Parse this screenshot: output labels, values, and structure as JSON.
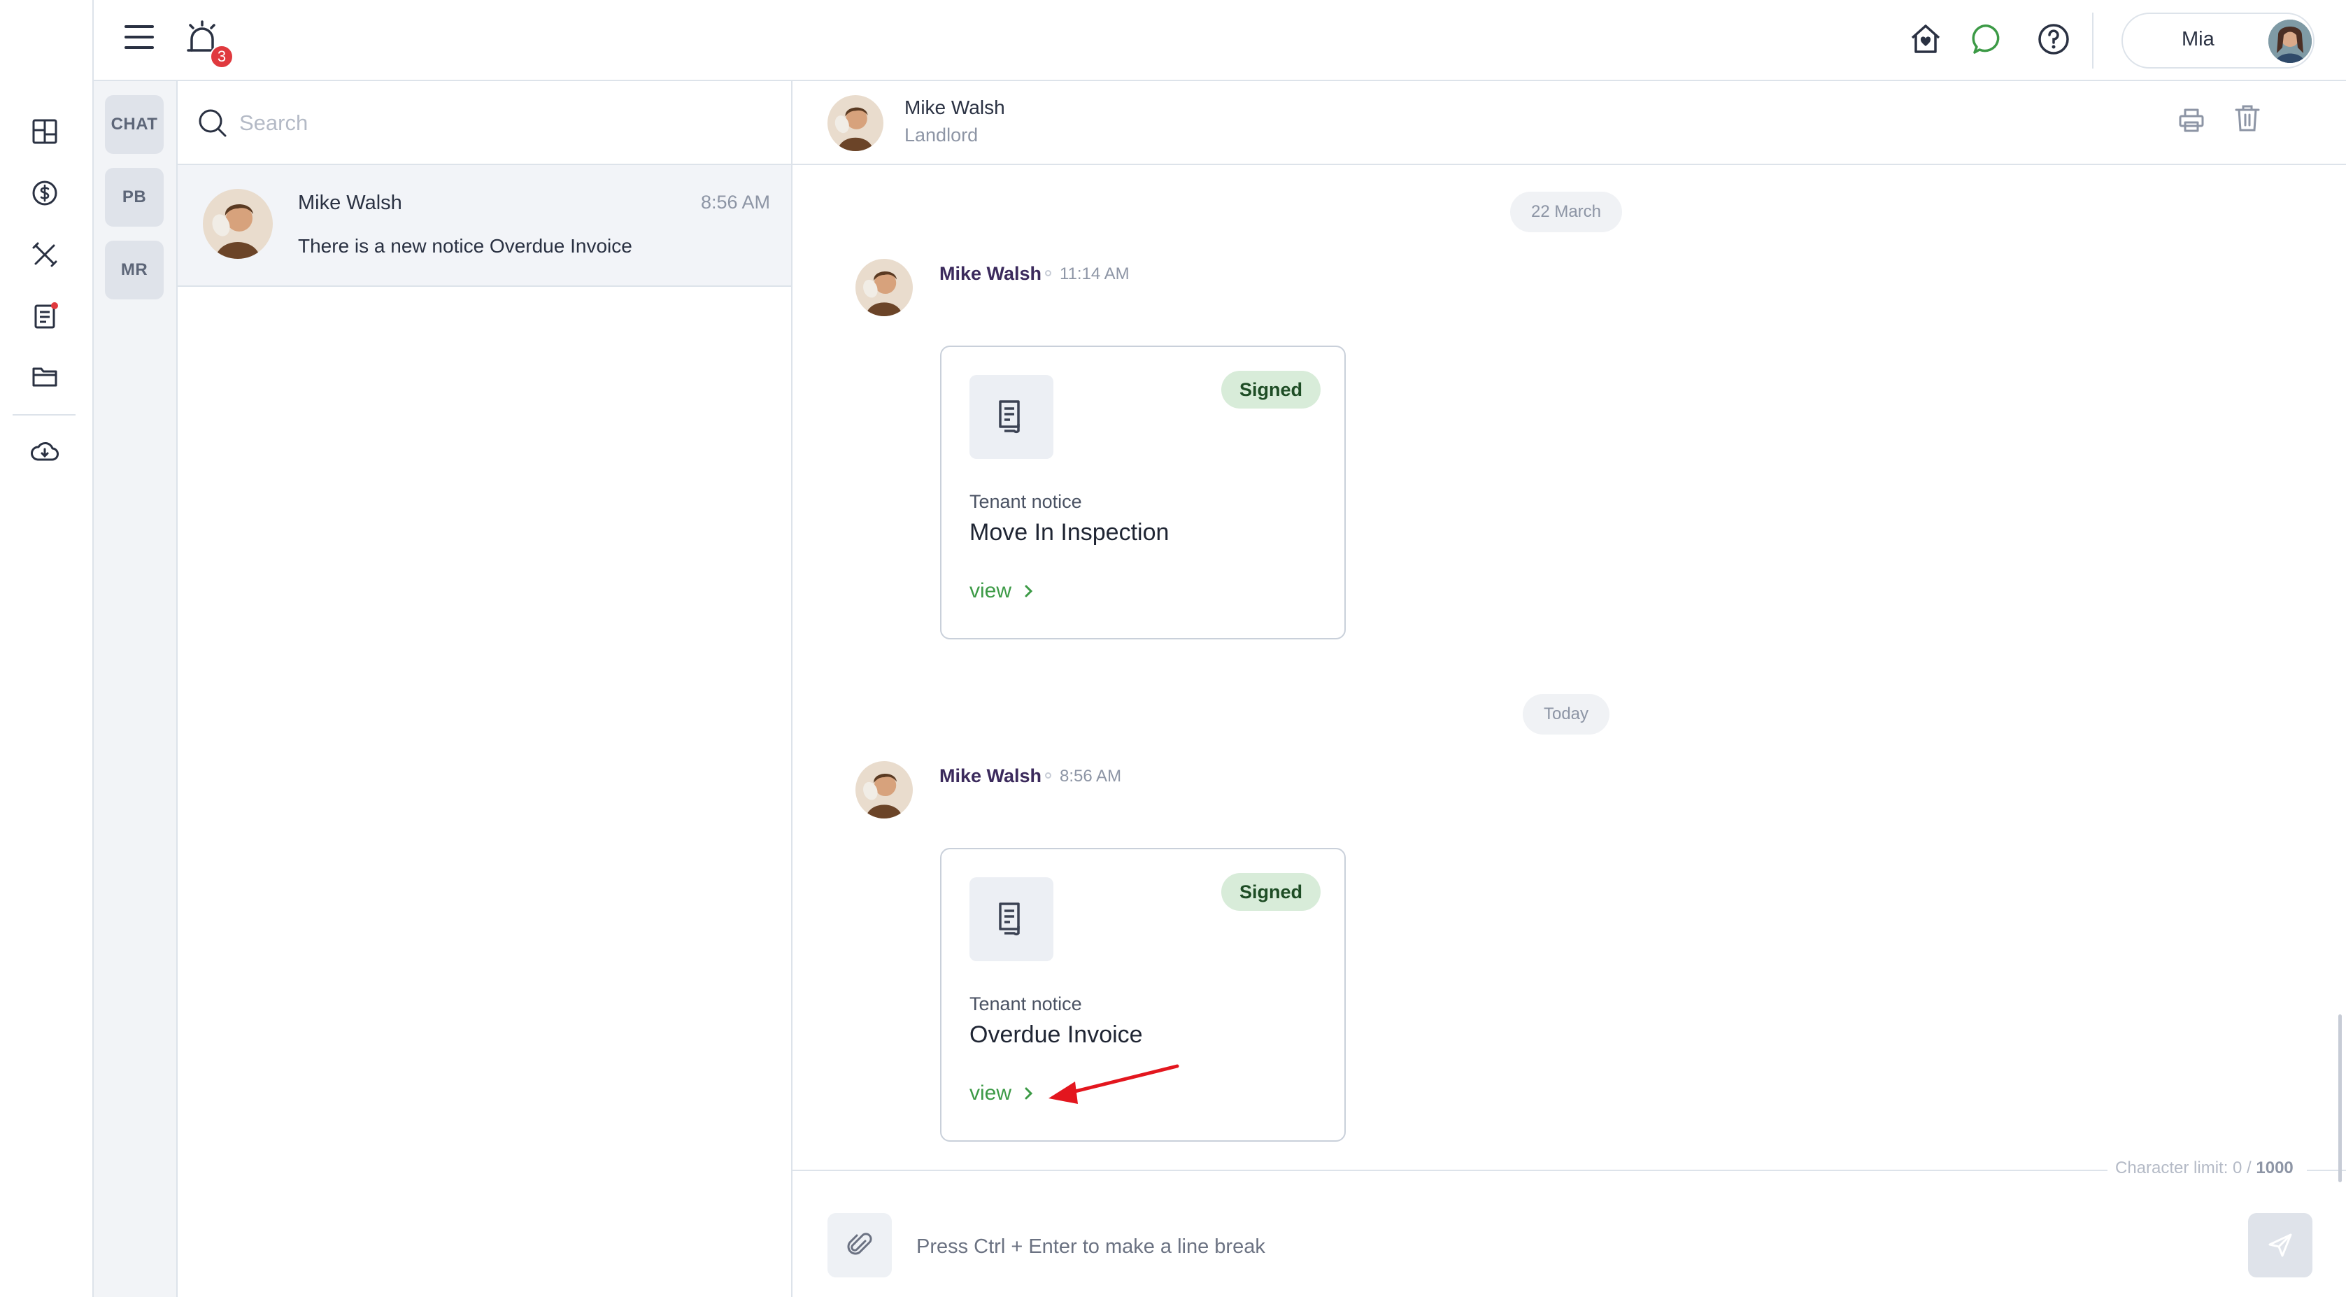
{
  "header": {
    "notification_count": "3",
    "user_name": "Mia"
  },
  "channels": [
    {
      "label": "CHAT"
    },
    {
      "label": "PB"
    },
    {
      "label": "MR"
    }
  ],
  "search": {
    "placeholder": "Search"
  },
  "conversation": {
    "name": "Mike Walsh",
    "time": "8:56 AM",
    "preview": "There is a new notice Overdue Invoice"
  },
  "chat_header": {
    "name": "Mike Walsh",
    "role": "Landlord"
  },
  "messages": [
    {
      "date_label": "22 March",
      "sender": "Mike Walsh",
      "time": "11:14 AM",
      "card": {
        "status": "Signed",
        "kind": "Tenant notice",
        "title": "Move In Inspection",
        "link": "view"
      }
    },
    {
      "date_label": "Today",
      "sender": "Mike Walsh",
      "time": "8:56 AM",
      "card": {
        "status": "Signed",
        "kind": "Tenant notice",
        "title": "Overdue Invoice",
        "link": "view"
      }
    }
  ],
  "composer": {
    "char_limit_label": "Character limit: 0 /",
    "char_limit_max": "1000",
    "placeholder": "Press Ctrl + Enter to make a line break"
  },
  "colors": {
    "accent_green": "#3c9a46",
    "badge_bg": "#d8ecd9",
    "notification_red": "#e0393e",
    "annotation_arrow": "#e3161e"
  }
}
